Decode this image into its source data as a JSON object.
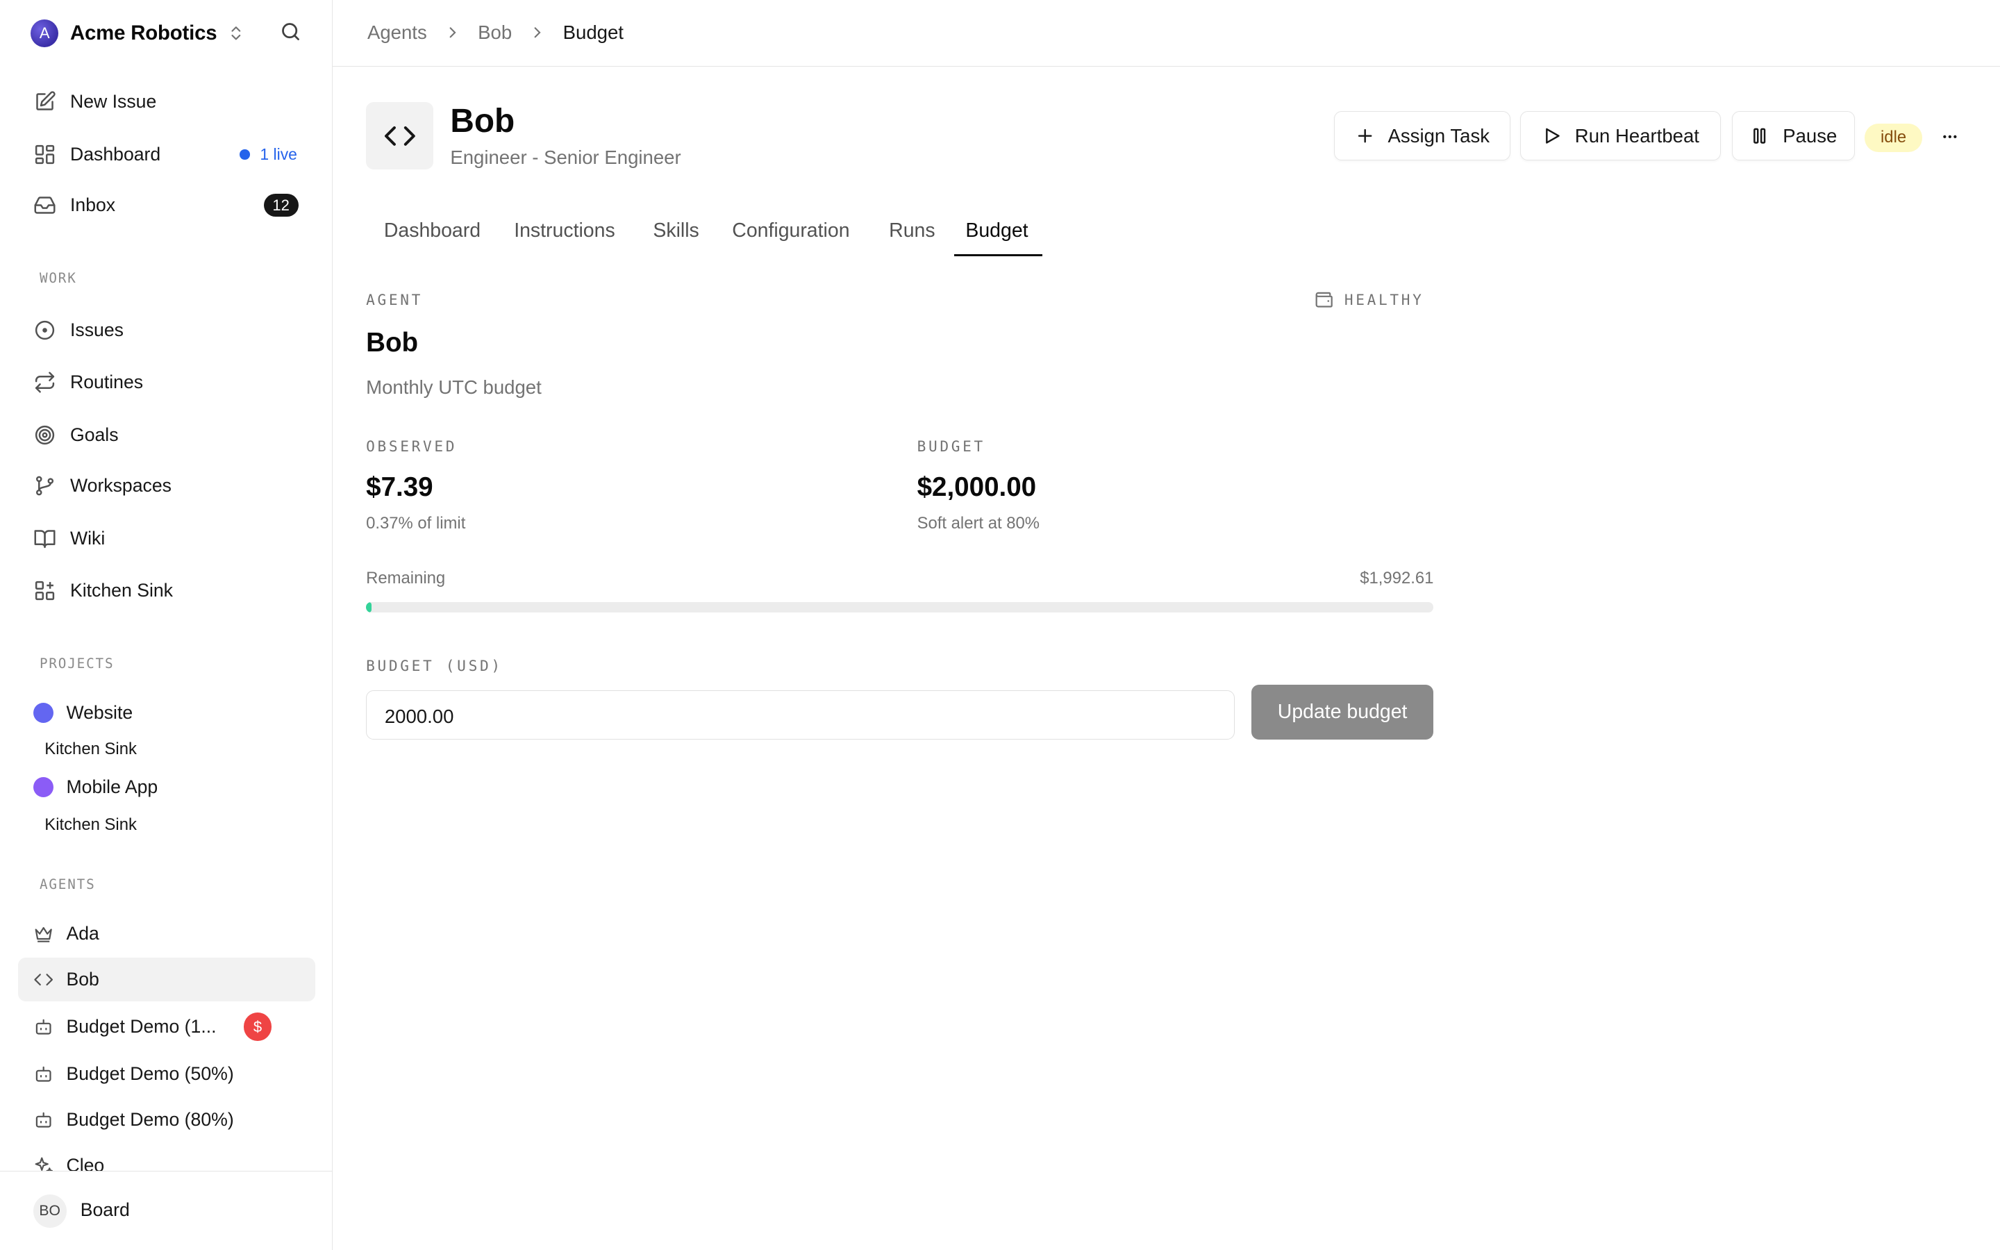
{
  "sidebar": {
    "org_initial": "A",
    "org_name": "Acme Robotics",
    "nav": {
      "new_issue": "New Issue",
      "dashboard": "Dashboard",
      "dashboard_live": "1 live",
      "inbox": "Inbox",
      "inbox_count": "12"
    },
    "work_label": "WORK",
    "work_items": [
      "Issues",
      "Routines",
      "Goals",
      "Workspaces",
      "Wiki",
      "Kitchen Sink"
    ],
    "projects_label": "PROJECTS",
    "projects": [
      {
        "name": "Website",
        "color": "#6366f1",
        "sub": "Kitchen Sink"
      },
      {
        "name": "Mobile App",
        "color": "#8b5cf6",
        "sub": "Kitchen Sink"
      }
    ],
    "agents_label": "AGENTS",
    "agents": [
      "Ada",
      "Bob",
      "Budget Demo (1...",
      "Budget Demo (50%)",
      "Budget Demo (80%)",
      "Cleo"
    ],
    "budget_alert_symbol": "$",
    "user_initials": "BO",
    "user_name": "Board"
  },
  "breadcrumb": [
    "Agents",
    "Bob",
    "Budget"
  ],
  "agent": {
    "name": "Bob",
    "role": "Engineer - Senior Engineer",
    "status": "idle"
  },
  "actions": {
    "assign_task": "Assign Task",
    "run_heartbeat": "Run Heartbeat",
    "pause": "Pause"
  },
  "tabs": [
    "Dashboard",
    "Instructions",
    "Skills",
    "Configuration",
    "Runs",
    "Budget"
  ],
  "active_tab": "Budget",
  "budget": {
    "scope_label": "AGENT",
    "health": "HEALTHY",
    "title": "Bob",
    "period": "Monthly UTC budget",
    "observed_label": "OBSERVED",
    "observed_value": "$7.39",
    "observed_pct": "0.37% of limit",
    "budget_label": "BUDGET",
    "budget_value": "$2,000.00",
    "soft_alert": "Soft alert at 80%",
    "remaining_label": "Remaining",
    "remaining_value": "$1,992.61",
    "used_fraction": 0.0037,
    "input_label": "BUDGET (USD)",
    "input_value": "2000.00",
    "update_label": "Update budget"
  },
  "colors": {
    "accent_blue": "#2563eb",
    "progress_green": "#34d399",
    "alert_red": "#ef4444",
    "idle_bg": "#fef9c3"
  }
}
